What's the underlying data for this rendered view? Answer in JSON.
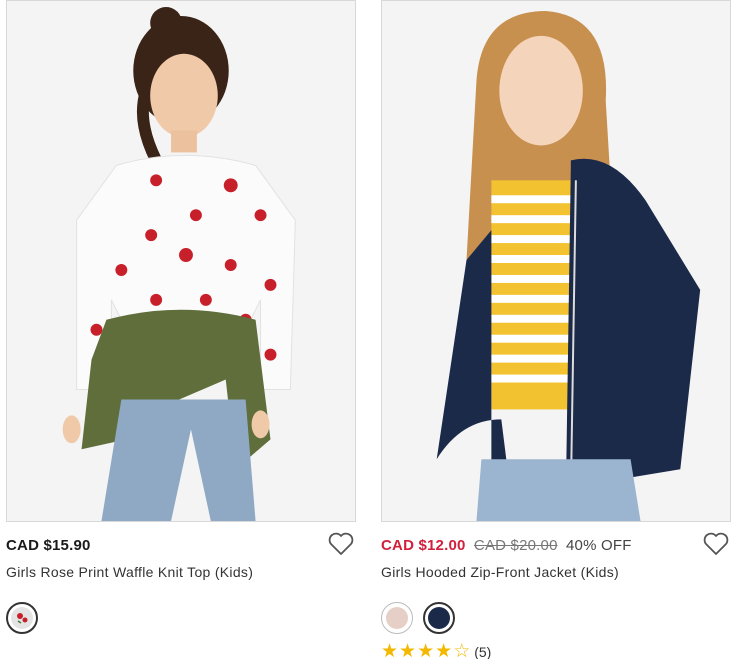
{
  "products": [
    {
      "price": "CAD $15.90",
      "original_price": "",
      "discount": "",
      "name": "Girls Rose Print Waffle Knit Top (Kids)",
      "swatches": [
        "#d9d9d9"
      ],
      "rating": null,
      "review_count": ""
    },
    {
      "price": "CAD $12.00",
      "original_price": "CAD $20.00",
      "discount": "40% OFF",
      "name": "Girls Hooded Zip-Front Jacket (Kids)",
      "swatches": [
        "#e6cfc6",
        "#1c2a4a"
      ],
      "rating": 4,
      "review_count": "(5)"
    }
  ],
  "colors": {
    "sale_price": "#d21f3c",
    "star": "#f5b800"
  }
}
